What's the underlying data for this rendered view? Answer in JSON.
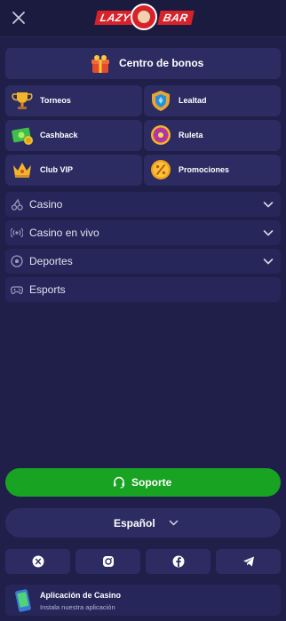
{
  "header": {
    "logo_left": "LAZY",
    "logo_right": "BAR",
    "close_icon": "close-icon"
  },
  "bonus_center": {
    "label": "Centro de bonos",
    "icon": "gift-icon"
  },
  "tiles": [
    {
      "label": "Torneos",
      "icon": "trophy-icon"
    },
    {
      "label": "Lealtad",
      "icon": "loyalty-shield-icon"
    },
    {
      "label": "Cashback",
      "icon": "cashback-icon"
    },
    {
      "label": "Ruleta",
      "icon": "roulette-icon"
    },
    {
      "label": "Club VIP",
      "icon": "crown-icon"
    },
    {
      "label": "Promociones",
      "icon": "percent-coin-icon"
    }
  ],
  "nav": [
    {
      "label": "Casino",
      "icon": "cherry-icon",
      "expandable": true
    },
    {
      "label": "Casino en vivo",
      "icon": "live-broadcast-icon",
      "expandable": true
    },
    {
      "label": "Deportes",
      "icon": "soccer-ball-icon",
      "expandable": true
    },
    {
      "label": "Esports",
      "icon": "gamepad-icon",
      "expandable": false
    }
  ],
  "support": {
    "label": "Soporte",
    "icon": "headset-icon"
  },
  "language": {
    "label": "Español",
    "icon": "chevron-down-icon"
  },
  "social": [
    "x-icon",
    "instagram-icon",
    "facebook-icon",
    "telegram-icon"
  ],
  "app_banner": {
    "title": "Aplicación de Casino",
    "subtitle": "Instala nuestra aplicación",
    "icon": "phone-icon"
  },
  "colors": {
    "background": "#1f1f4a",
    "card": "#2c2c63",
    "support_green": "#18a322",
    "brand_red": "#d8222a"
  }
}
